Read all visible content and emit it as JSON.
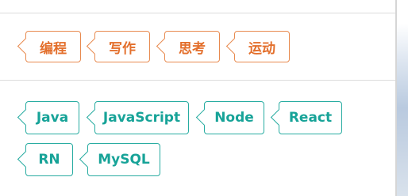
{
  "category_tags": [
    {
      "label": "编程"
    },
    {
      "label": "写作"
    },
    {
      "label": "思考"
    },
    {
      "label": "运动"
    }
  ],
  "tech_tags": [
    {
      "label": "Java"
    },
    {
      "label": "JavaScript"
    },
    {
      "label": "Node"
    },
    {
      "label": "React"
    },
    {
      "label": "RN"
    },
    {
      "label": "MySQL"
    }
  ],
  "colors": {
    "category_tag": "#e36f2c",
    "tech_tag": "#17a398",
    "divider": "#dcdcdc"
  }
}
